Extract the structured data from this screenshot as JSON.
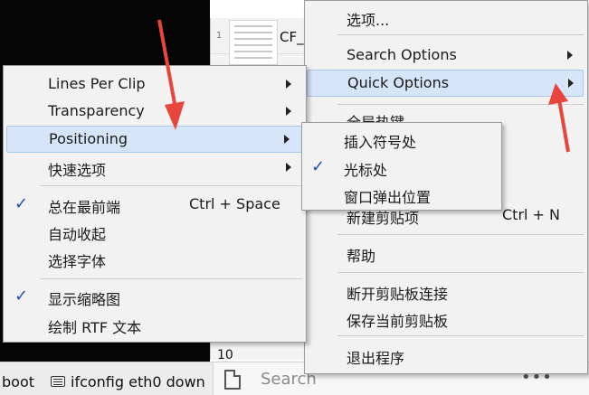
{
  "background": {
    "clip_label": "CF_",
    "row_numbers": [
      "1",
      "10"
    ]
  },
  "taskbar": {
    "item1_label": "boot",
    "item2_label": "ifconfig eth0 down",
    "search_placeholder": "Search",
    "more_label": "•••"
  },
  "main_menu": {
    "items": [
      {
        "label": "选项..."
      },
      {
        "label": "Search Options"
      },
      {
        "label": "Quick Options"
      },
      {
        "label": "全局热键"
      },
      {
        "label": "新建剪贴项",
        "shortcut": "Ctrl + N"
      },
      {
        "label": "帮助"
      },
      {
        "label": "断开剪贴板连接"
      },
      {
        "label": "保存当前剪贴板"
      },
      {
        "label": "退出程序"
      }
    ]
  },
  "quick_menu": {
    "items": [
      {
        "label": "Lines Per Clip"
      },
      {
        "label": "Transparency"
      },
      {
        "label": "Positioning"
      },
      {
        "label": "快速选项"
      },
      {
        "label": "总在最前端",
        "shortcut": "Ctrl + Space",
        "checked": true
      },
      {
        "label": "自动收起"
      },
      {
        "label": "选择字体"
      },
      {
        "label": "显示缩略图",
        "checked": true
      },
      {
        "label": "绘制 RTF 文本"
      }
    ]
  },
  "positioning_menu": {
    "items": [
      {
        "label": "插入符号处"
      },
      {
        "label": "光标处",
        "checked": true
      },
      {
        "label": "窗口弹出位置"
      }
    ]
  },
  "colors": {
    "highlight": "#d6e6f8",
    "check": "#1f4fb0",
    "arrow_annotation": "#e8453c"
  },
  "icons": {
    "submenu": "chevron-right-icon",
    "check": "checkmark-icon"
  }
}
